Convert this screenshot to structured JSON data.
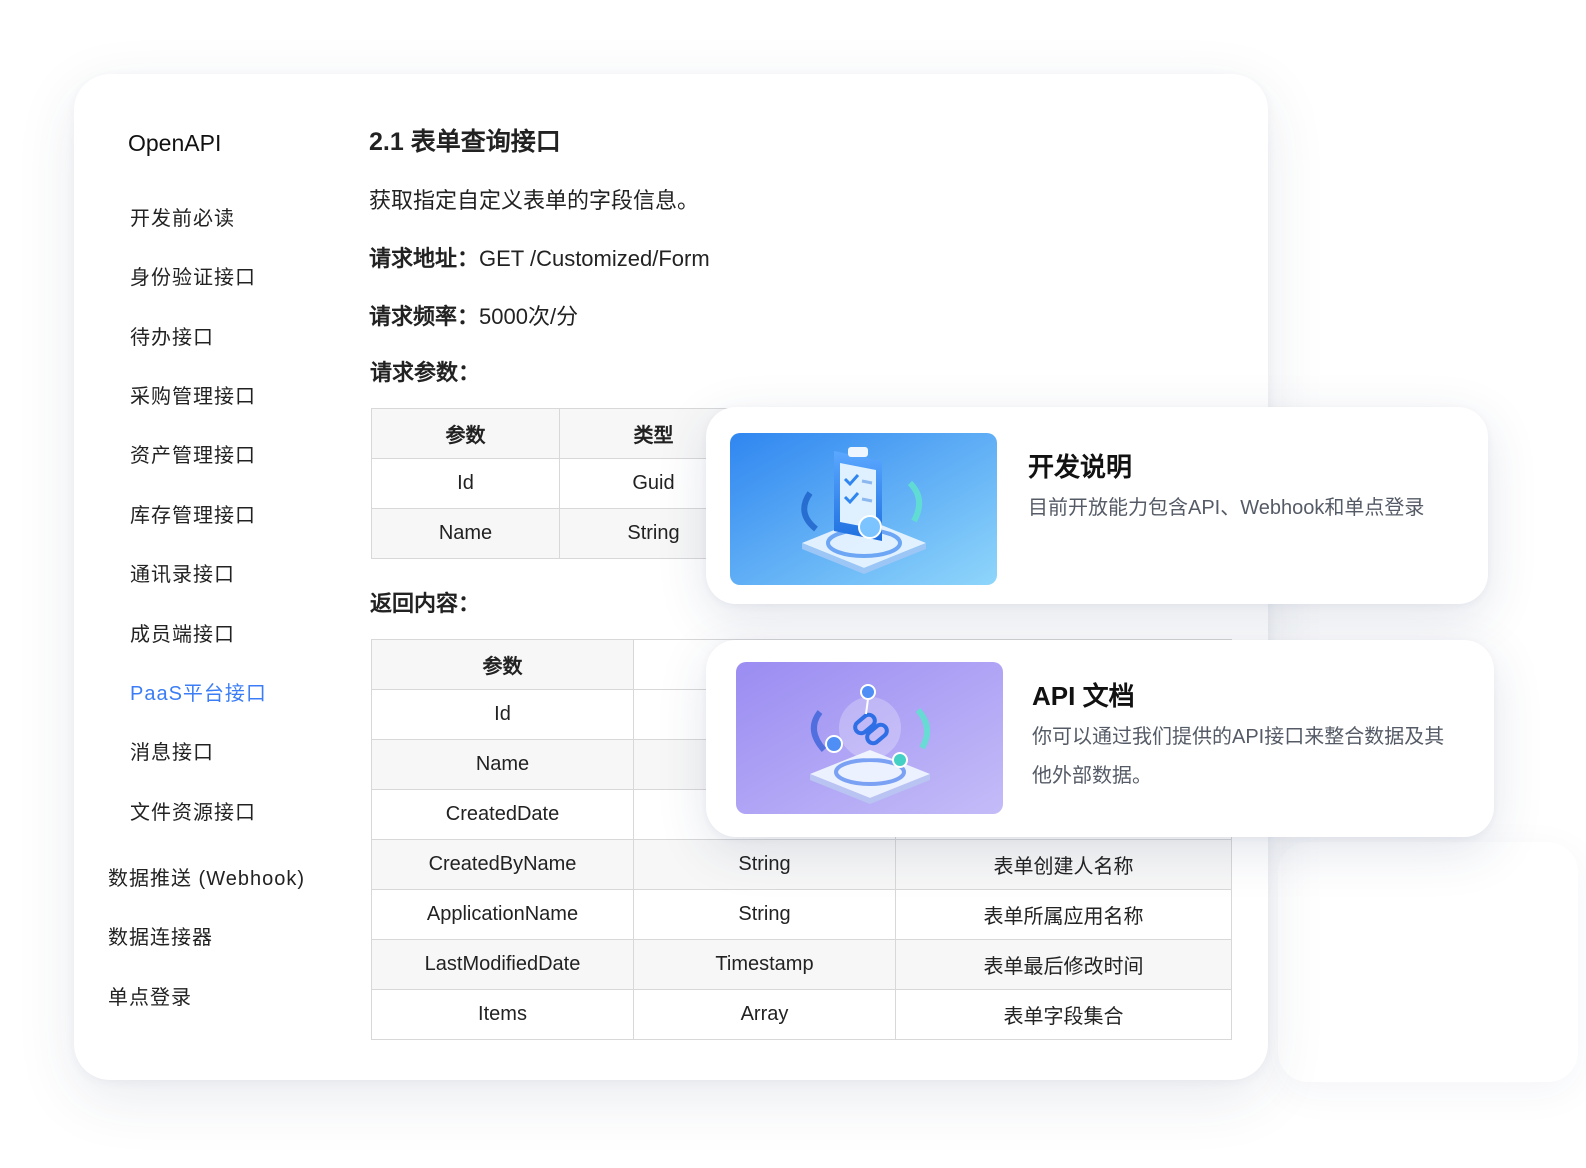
{
  "sidebar": {
    "title": "OpenAPI",
    "items": [
      {
        "label": "开发前必读",
        "level": "sub",
        "active": false
      },
      {
        "label": "身份验证接口",
        "level": "sub",
        "active": false
      },
      {
        "label": "待办接口",
        "level": "sub",
        "active": false
      },
      {
        "label": "采购管理接口",
        "level": "sub",
        "active": false
      },
      {
        "label": "资产管理接口",
        "level": "sub",
        "active": false
      },
      {
        "label": "库存管理接口",
        "level": "sub",
        "active": false
      },
      {
        "label": "通讯录接口",
        "level": "sub",
        "active": false
      },
      {
        "label": "成员端接口",
        "level": "sub",
        "active": false
      },
      {
        "label": "PaaS平台接口",
        "level": "sub",
        "active": true
      },
      {
        "label": "消息接口",
        "level": "sub",
        "active": false
      },
      {
        "label": "文件资源接口",
        "level": "sub",
        "active": false
      },
      {
        "label": "数据推送 (Webhook)",
        "level": "top",
        "active": false
      },
      {
        "label": "数据连接器",
        "level": "top",
        "active": false
      },
      {
        "label": "单点登录",
        "level": "top",
        "active": false
      }
    ]
  },
  "main": {
    "heading": "2.1 表单查询接口",
    "description": "获取指定自定义表单的字段信息。",
    "request_url_label": "请求地址：",
    "request_url_value": "GET /Customized/Form",
    "rate_label": "请求频率：",
    "rate_value": "5000次/分",
    "params_label": "请求参数：",
    "params_table": {
      "headers": [
        "参数",
        "类型"
      ],
      "rows": [
        [
          "Id",
          "Guid"
        ],
        [
          "Name",
          "String"
        ]
      ]
    },
    "return_label": "返回内容：",
    "return_table": {
      "headers": [
        "参数",
        "",
        ""
      ],
      "rows": [
        [
          "Id",
          "",
          ""
        ],
        [
          "Name",
          "",
          ""
        ],
        [
          "CreatedDate",
          "",
          ""
        ],
        [
          "CreatedByName",
          "String",
          "表单创建人名称"
        ],
        [
          "ApplicationName",
          "String",
          "表单所属应用名称"
        ],
        [
          "LastModifiedDate",
          "Timestamp",
          "表单最后修改时间"
        ],
        [
          "Items",
          "Array",
          "表单字段集合"
        ]
      ]
    }
  },
  "cards": [
    {
      "title": "开发说明",
      "text": "目前开放能力包含API、Webhook和单点登录",
      "icon": "clipboard-checklist-icon",
      "gradient": [
        "#2f86f0",
        "#8fd6fb"
      ]
    },
    {
      "title": "API 文档",
      "text": "你可以通过我们提供的API接口来整合数据及其他外部数据。",
      "icon": "link-chain-icon",
      "gradient": [
        "#9a8cf2",
        "#c4bcf8"
      ]
    }
  ],
  "colors": {
    "accent": "#3b7df6",
    "table_border": "#d8d8d8",
    "table_alt_row": "#f7f7f7"
  }
}
